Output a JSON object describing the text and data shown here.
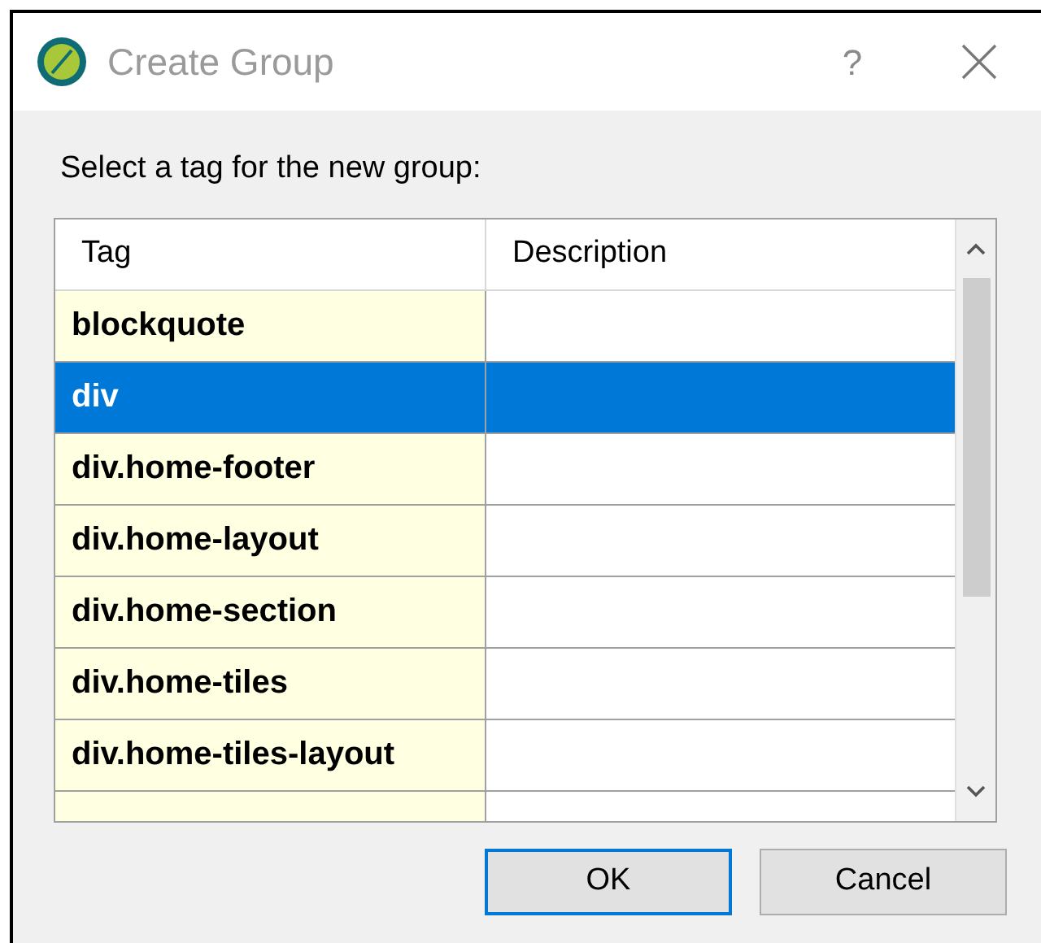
{
  "window": {
    "title": "Create Group",
    "help": "?"
  },
  "prompt": "Select a tag for the new group:",
  "table": {
    "columns": [
      "Tag",
      "Description"
    ],
    "rows": [
      {
        "tag": "blockquote",
        "selected": false
      },
      {
        "tag": "div",
        "selected": true
      },
      {
        "tag": "div.home-footer",
        "selected": false
      },
      {
        "tag": "div.home-layout",
        "selected": false
      },
      {
        "tag": "div.home-section",
        "selected": false
      },
      {
        "tag": "div.home-tiles",
        "selected": false
      },
      {
        "tag": "div.home-tiles-layout",
        "selected": false
      }
    ]
  },
  "buttons": [
    {
      "label": "OK",
      "default": true
    },
    {
      "label": "Cancel",
      "default": false
    }
  ]
}
